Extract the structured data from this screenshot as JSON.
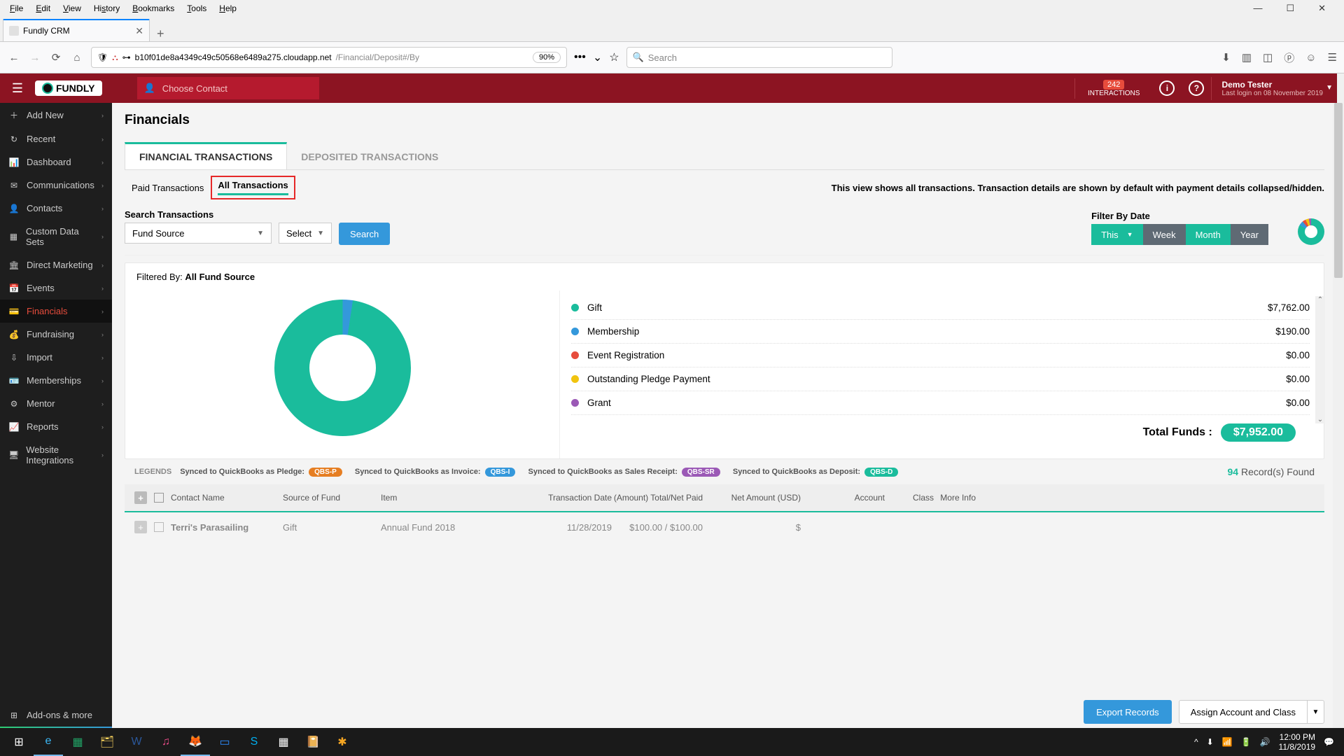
{
  "browser": {
    "menus": [
      "File",
      "Edit",
      "View",
      "History",
      "Bookmarks",
      "Tools",
      "Help"
    ],
    "tab_title": "Fundly CRM",
    "url_host": "b10f01de8a4349c49c50568e6489a275.cloudapp.net",
    "url_path": "/Financial/Deposit#/By",
    "zoom": "90%",
    "search_placeholder": "Search"
  },
  "header": {
    "logo_text": "FUNDLY",
    "contact_placeholder": "Choose Contact",
    "interactions_count": "242",
    "interactions_label": "INTERACTIONS",
    "user_name": "Demo Tester",
    "user_sub": "Last login on 08 November 2019"
  },
  "sidebar": {
    "items": [
      {
        "icon": "＋",
        "label": "Add New"
      },
      {
        "icon": "↻",
        "label": "Recent"
      },
      {
        "icon": "📊",
        "label": "Dashboard"
      },
      {
        "icon": "✉",
        "label": "Communications"
      },
      {
        "icon": "👤",
        "label": "Contacts"
      },
      {
        "icon": "▦",
        "label": "Custom Data Sets"
      },
      {
        "icon": "🏛",
        "label": "Direct Marketing"
      },
      {
        "icon": "📅",
        "label": "Events"
      },
      {
        "icon": "💳",
        "label": "Financials"
      },
      {
        "icon": "💰",
        "label": "Fundraising"
      },
      {
        "icon": "⇩",
        "label": "Import"
      },
      {
        "icon": "🪪",
        "label": "Memberships"
      },
      {
        "icon": "⚙",
        "label": "Mentor"
      },
      {
        "icon": "📈",
        "label": "Reports"
      },
      {
        "icon": "🖥",
        "label": "Website Integrations"
      }
    ],
    "active_index": 8,
    "addons": "Add-ons & more"
  },
  "page": {
    "title": "Financials",
    "primary_tabs": [
      "FINANCIAL TRANSACTIONS",
      "DEPOSITED TRANSACTIONS"
    ],
    "primary_active": 0,
    "sub_tabs": [
      "Paid Transactions",
      "All Transactions"
    ],
    "sub_active": 1,
    "sub_desc": "This view shows all transactions. Transaction details are shown by default with payment details collapsed/hidden.",
    "search_label": "Search Transactions",
    "fund_source": "Fund Source",
    "select_label": "Select",
    "search_btn": "Search",
    "filter_date_label": "Filter By Date",
    "date_segs": {
      "this": "This",
      "week": "Week",
      "month": "Month",
      "year": "Year"
    },
    "date_active": "month",
    "filtered_prefix": "Filtered By:",
    "filtered_value": "All Fund Source",
    "legend": [
      {
        "color": "#1abc9c",
        "label": "Gift",
        "amount": "$7,762.00"
      },
      {
        "color": "#3498db",
        "label": "Membership",
        "amount": "$190.00"
      },
      {
        "color": "#e74c3c",
        "label": "Event Registration",
        "amount": "$0.00"
      },
      {
        "color": "#f1c40f",
        "label": "Outstanding Pledge Payment",
        "amount": "$0.00"
      },
      {
        "color": "#9b59b6",
        "label": "Grant",
        "amount": "$0.00"
      }
    ],
    "total_label": "Total Funds :",
    "total_value": "$7,952.00",
    "qb_legends_label": "LEGENDS",
    "qb_legends": [
      {
        "text": "Synced to QuickBooks as Pledge:",
        "pill": "QBS-P",
        "color": "#e67e22"
      },
      {
        "text": "Synced to QuickBooks as Invoice:",
        "pill": "QBS-I",
        "color": "#3498db"
      },
      {
        "text": "Synced to QuickBooks as Sales Receipt:",
        "pill": "QBS-SR",
        "color": "#9b59b6"
      },
      {
        "text": "Synced to QuickBooks as Deposit:",
        "pill": "QBS-D",
        "color": "#1abc9c"
      }
    ],
    "records_count": "94",
    "records_label": "Record(s) Found",
    "columns": {
      "contact": "Contact Name",
      "source": "Source of Fund",
      "item": "Item",
      "tdate": "Transaction Date",
      "amt": "(Amount) Total/Net Paid",
      "net": "Net Amount (USD)",
      "acct": "Account",
      "class": "Class",
      "more": "More Info"
    },
    "row0": {
      "contact": "Terri's Parasailing",
      "source": "Gift",
      "item": "Annual Fund 2018",
      "tdate": "11/28/2019",
      "amt": "$100.00 / $100.00",
      "net": "$"
    },
    "export_btn": "Export Records",
    "assign_btn": "Assign Account and Class"
  },
  "taskbar": {
    "time": "12:00 PM",
    "date": "11/8/2019"
  },
  "chart_data": {
    "type": "pie",
    "title": "All Fund Source",
    "series": [
      {
        "name": "Gift",
        "value": 7762.0,
        "color": "#1abc9c"
      },
      {
        "name": "Membership",
        "value": 190.0,
        "color": "#3498db"
      },
      {
        "name": "Event Registration",
        "value": 0.0,
        "color": "#e74c3c"
      },
      {
        "name": "Outstanding Pledge Payment",
        "value": 0.0,
        "color": "#f1c40f"
      },
      {
        "name": "Grant",
        "value": 0.0,
        "color": "#9b59b6"
      }
    ],
    "total": 7952.0
  }
}
